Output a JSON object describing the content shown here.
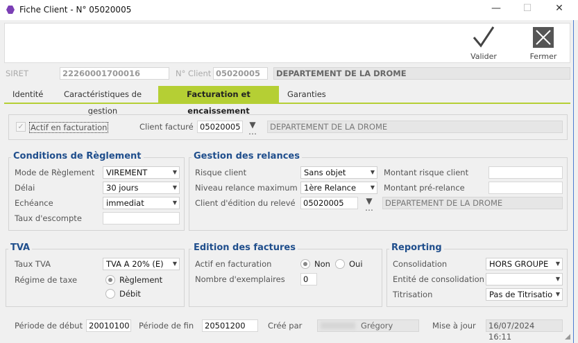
{
  "window": {
    "title": "Fiche Client - N° 05020005",
    "icon": "app-hexagon-icon",
    "accent": "#b5cf34",
    "legend_color": "#1f4e8c"
  },
  "toolbar": {
    "validate_label": "Valider",
    "close_label": "Fermer"
  },
  "header": {
    "siret_label": "SIRET",
    "siret_value": "22260001700016",
    "client_no_label": "N° Client",
    "client_no_value": "05020005",
    "client_name": "DEPARTEMENT DE LA DROME"
  },
  "tabs": [
    {
      "label": "Identité"
    },
    {
      "label": "Caractéristiques de gestion"
    },
    {
      "label": "Facturation et encaissement",
      "active": true
    },
    {
      "label": "Garanties"
    }
  ],
  "billing": {
    "active_label": "Actif en facturation",
    "active_checked": true,
    "client_billed_label": "Client facturé",
    "client_billed_value": "05020005",
    "client_billed_name": "DEPARTEMENT DE LA DROME"
  },
  "conditions": {
    "title": "Conditions de Règlement",
    "mode_label": "Mode de Règlement",
    "mode_value": "VIREMENT",
    "delai_label": "Délai",
    "delai_value": "30 jours",
    "echeance_label": "Echéance",
    "echeance_value": "immediat",
    "escompte_label": "Taux d'escompte",
    "escompte_value": ""
  },
  "relances": {
    "title": "Gestion des relances",
    "risque_label": "Risque client",
    "risque_value": "Sans objet",
    "niveau_label": "Niveau relance maximum",
    "niveau_value": "1ère Relance",
    "edition_label": "Client d'édition du relevé",
    "edition_value": "05020005",
    "edition_name": "DEPARTEMENT DE LA DROME",
    "montant_risque_label": "Montant risque client",
    "montant_risque_value": "",
    "montant_pre_label": "Montant pré-relance",
    "montant_pre_value": ""
  },
  "tva": {
    "title": "TVA",
    "taux_label": "Taux TVA",
    "taux_value": "TVA A 20% (E)",
    "regime_label": "Régime de taxe",
    "opt_reglement": "Règlement",
    "opt_debit": "Débit",
    "selected": "Règlement"
  },
  "edition": {
    "title": "Edition des factures",
    "actif_label": "Actif en facturation",
    "opt_non": "Non",
    "opt_oui": "Oui",
    "selected": "Non",
    "nb_label": "Nombre d'exemplaires",
    "nb_value": "0"
  },
  "reporting": {
    "title": "Reporting",
    "conso_label": "Consolidation",
    "conso_value": "HORS GROUPE",
    "entite_label": "Entité de consolidation",
    "entite_value": "",
    "titrisation_label": "Titrisation",
    "titrisation_value": "Pas de Titrisatio"
  },
  "footer": {
    "debut_label": "Période de début",
    "debut_value": "20010100",
    "fin_label": "Période de fin",
    "fin_value": "20501200",
    "cree_label": "Créé par",
    "cree_value": "Grégory",
    "maj_label": "Mise à jour",
    "maj_value": "16/07/2024 16:11"
  }
}
